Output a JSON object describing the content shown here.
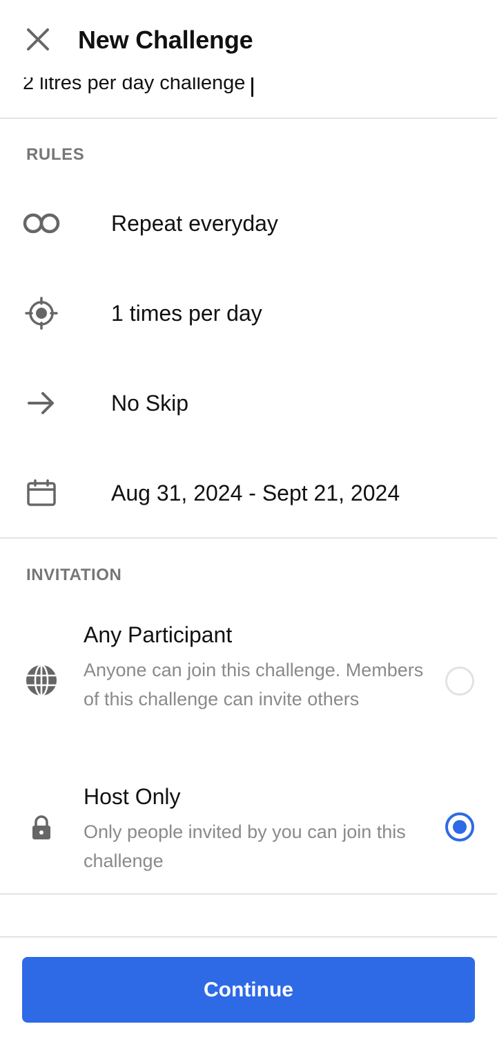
{
  "header": {
    "title": "New Challenge",
    "close_icon": "close-icon"
  },
  "challenge_name": {
    "value": "2 litres per day challenge"
  },
  "rules": {
    "section_label": "RULES",
    "items": [
      {
        "icon": "infinity-icon",
        "label": "Repeat everyday"
      },
      {
        "icon": "target-icon",
        "label": "1 times per day"
      },
      {
        "icon": "arrow-right-icon",
        "label": "No Skip"
      },
      {
        "icon": "calendar-icon",
        "label": "Aug 31, 2024 - Sept 21, 2024"
      }
    ]
  },
  "invitation": {
    "section_label": "INVITATION",
    "options": [
      {
        "icon": "globe-icon",
        "title": "Any Participant",
        "description": "Anyone can join this challenge. Members of this challenge can invite others",
        "selected": false
      },
      {
        "icon": "lock-icon",
        "title": "Host Only",
        "description": "Only people invited by you can join this challenge",
        "selected": true
      }
    ]
  },
  "footer": {
    "continue_label": "Continue"
  },
  "colors": {
    "accent": "#2e6ae6",
    "muted_text": "#8a8a8a",
    "section_label": "#767676",
    "divider": "#e3e3e3"
  }
}
